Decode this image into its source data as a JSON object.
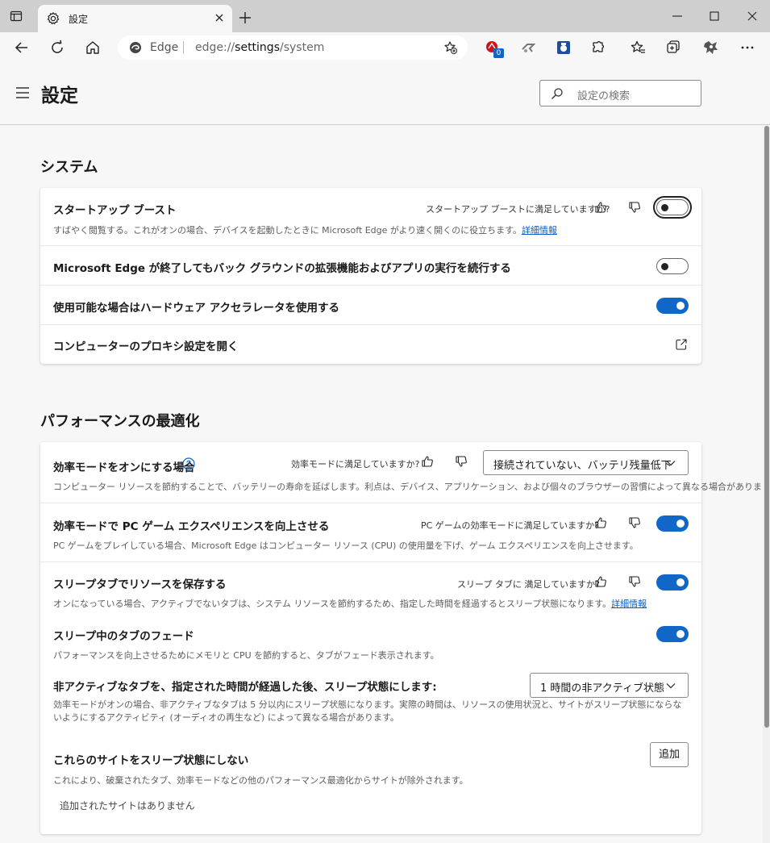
{
  "browser": {
    "tab_title": "設定",
    "edge_label": "Edge",
    "url_prefix": "edge://",
    "url_bold": "settings",
    "url_suffix": "/system",
    "extension_badge": "0"
  },
  "header": {
    "title": "設定",
    "search_placeholder": "設定の検索"
  },
  "system": {
    "title": "システム",
    "startup_boost": {
      "title": "スタートアップ ブースト",
      "feedback": "スタートアップ ブーストに満足していますか?",
      "desc": "すばやく閲覧する。これがオンの場合、デバイスを起動したときに Microsoft Edge がより速く開くのに役立ちます。",
      "link": "詳細情報",
      "state": "off"
    },
    "background": {
      "title": "Microsoft Edge が終了してもバック グラウンドの拡張機能およびアプリの実行を続行する",
      "state": "off"
    },
    "hardware": {
      "title": "使用可能な場合はハードウェア アクセラレータを使用する",
      "state": "on"
    },
    "proxy": {
      "title": "コンピューターのプロキシ設定を開く"
    }
  },
  "performance": {
    "title": "パフォーマンスの最適化",
    "efficiency": {
      "title": "効率モードをオンにする場合",
      "feedback": "効率モードに満足していますか?",
      "dropdown": "接続されていない、バッテリ残量低下",
      "desc": "コンピューター リソースを節約することで、バッテリーの寿命を延ばします。利点は、デバイス、アプリケーション、および個々のブラウザーの習慣によって異なる場合があります。"
    },
    "pc_game": {
      "title": "効率モードで PC ゲーム エクスペリエンスを向上させる",
      "feedback": "PC ゲームの効率モードに満足していますか?",
      "desc": "PC ゲームをプレイしている場合、Microsoft Edge はコンピューター リソース (CPU) の使用量を下げ、ゲーム エクスペリエンスを向上させます。",
      "state": "on"
    },
    "sleeping_tabs": {
      "title": "スリープタブでリソースを保存する",
      "feedback": "スリープ タブに 満足していますか?",
      "desc": "オンになっている場合、アクティブでないタブは、システム リソースを節約するため、指定した時間を経過するとスリープ状態になります。",
      "link": "詳細情報",
      "state": "on"
    },
    "fade": {
      "title": "スリープ中のタブのフェード",
      "desc": "パフォーマンスを向上させるためにメモリと CPU を節約すると、タブがフェード表示されます。",
      "state": "on"
    },
    "inactive": {
      "title": "非アクティブなタブを、指定された時間が経過した後、スリープ状態にします:",
      "dropdown": "1 時間の非アクティブ状態",
      "desc": "効率モードがオンの場合、非アクティブなタブは 5 分以内にスリープ状態になります。実際の時間は、リソースの使用状況と、サイトがスリープ状態にならないようにするアクティビティ (オーディオの再生など) によって異なる場合があります。"
    },
    "never_sleep": {
      "title": "これらのサイトをスリープ状態にしない",
      "add_button": "追加",
      "desc": "これにより、破棄されたタブ、効率モードなどの他のパフォーマンス最適化からサイトが除外されます。",
      "empty": "追加されたサイトはありません"
    }
  },
  "colors": {
    "accent": "#1167c7",
    "link": "#0b5fc6"
  }
}
